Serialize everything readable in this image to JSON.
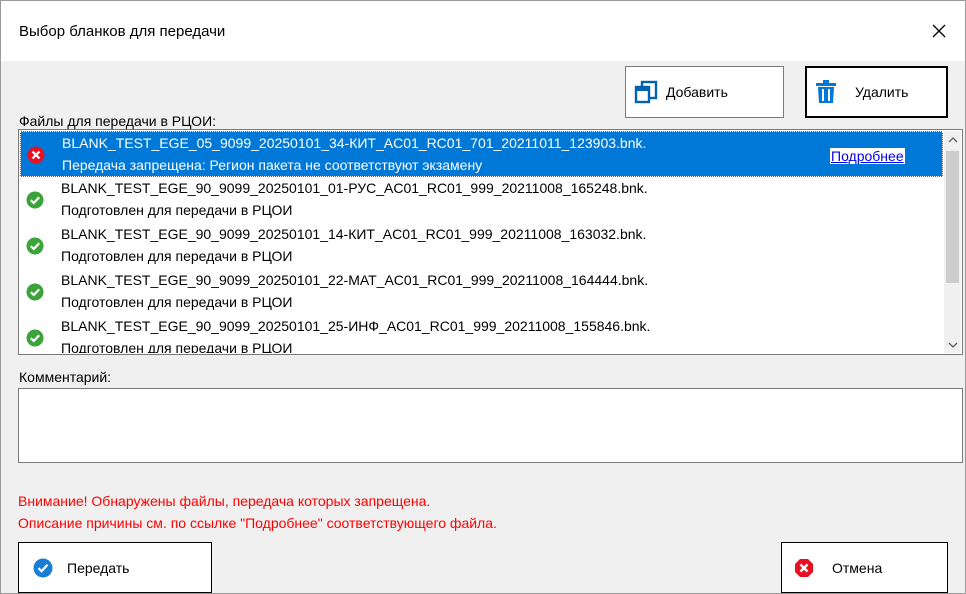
{
  "window": {
    "title": "Выбор бланков для передачи",
    "close_icon": "close-icon"
  },
  "toolbar": {
    "add_label": "Добавить",
    "add_icon": "copy-window-icon",
    "delete_label": "Удалить",
    "delete_icon": "trash-icon"
  },
  "files": {
    "label": "Файлы для передачи в РЦОИ:",
    "items": [
      {
        "name": "BLANK_TEST_EGE_05_9099_20250101_34-КИТ_AC01_RC01_701_20211011_123903.bnk.",
        "status": "Передача запрещена: Регион пакета не соответствуют экзамену",
        "state": "error",
        "link": "Подробнее"
      },
      {
        "name": "BLANK_TEST_EGE_90_9099_20250101_01-РУС_AC01_RC01_999_20211008_165248.bnk.",
        "status": "Подготовлен для передачи в РЦОИ",
        "state": "ok"
      },
      {
        "name": "BLANK_TEST_EGE_90_9099_20250101_14-КИТ_AC01_RC01_999_20211008_163032.bnk.",
        "status": "Подготовлен для передачи в РЦОИ",
        "state": "ok"
      },
      {
        "name": "BLANK_TEST_EGE_90_9099_20250101_22-МАТ_AC01_RC01_999_20211008_164444.bnk.",
        "status": "Подготовлен для передачи в РЦОИ",
        "state": "ok"
      },
      {
        "name": "BLANK_TEST_EGE_90_9099_20250101_25-ИНФ_AC01_RC01_999_20211008_155846.bnk.",
        "status": "Подготовлен для передачи в РЦОИ",
        "state": "ok"
      }
    ]
  },
  "comment": {
    "label": "Комментарий:",
    "value": ""
  },
  "warnings": {
    "line1": "Внимание! Обнаружены файлы, передача которых запрещена.",
    "line2": "Описание причины см. по ссылке \"Подробнее\" соответствующего файла."
  },
  "footer": {
    "send_label": "Передать",
    "cancel_label": "Отмена"
  },
  "colors": {
    "selection": "#0078d7",
    "error": "#e81123",
    "ok": "#3aa33a",
    "warning_text": "#ff0000",
    "link": "#0000ee"
  }
}
